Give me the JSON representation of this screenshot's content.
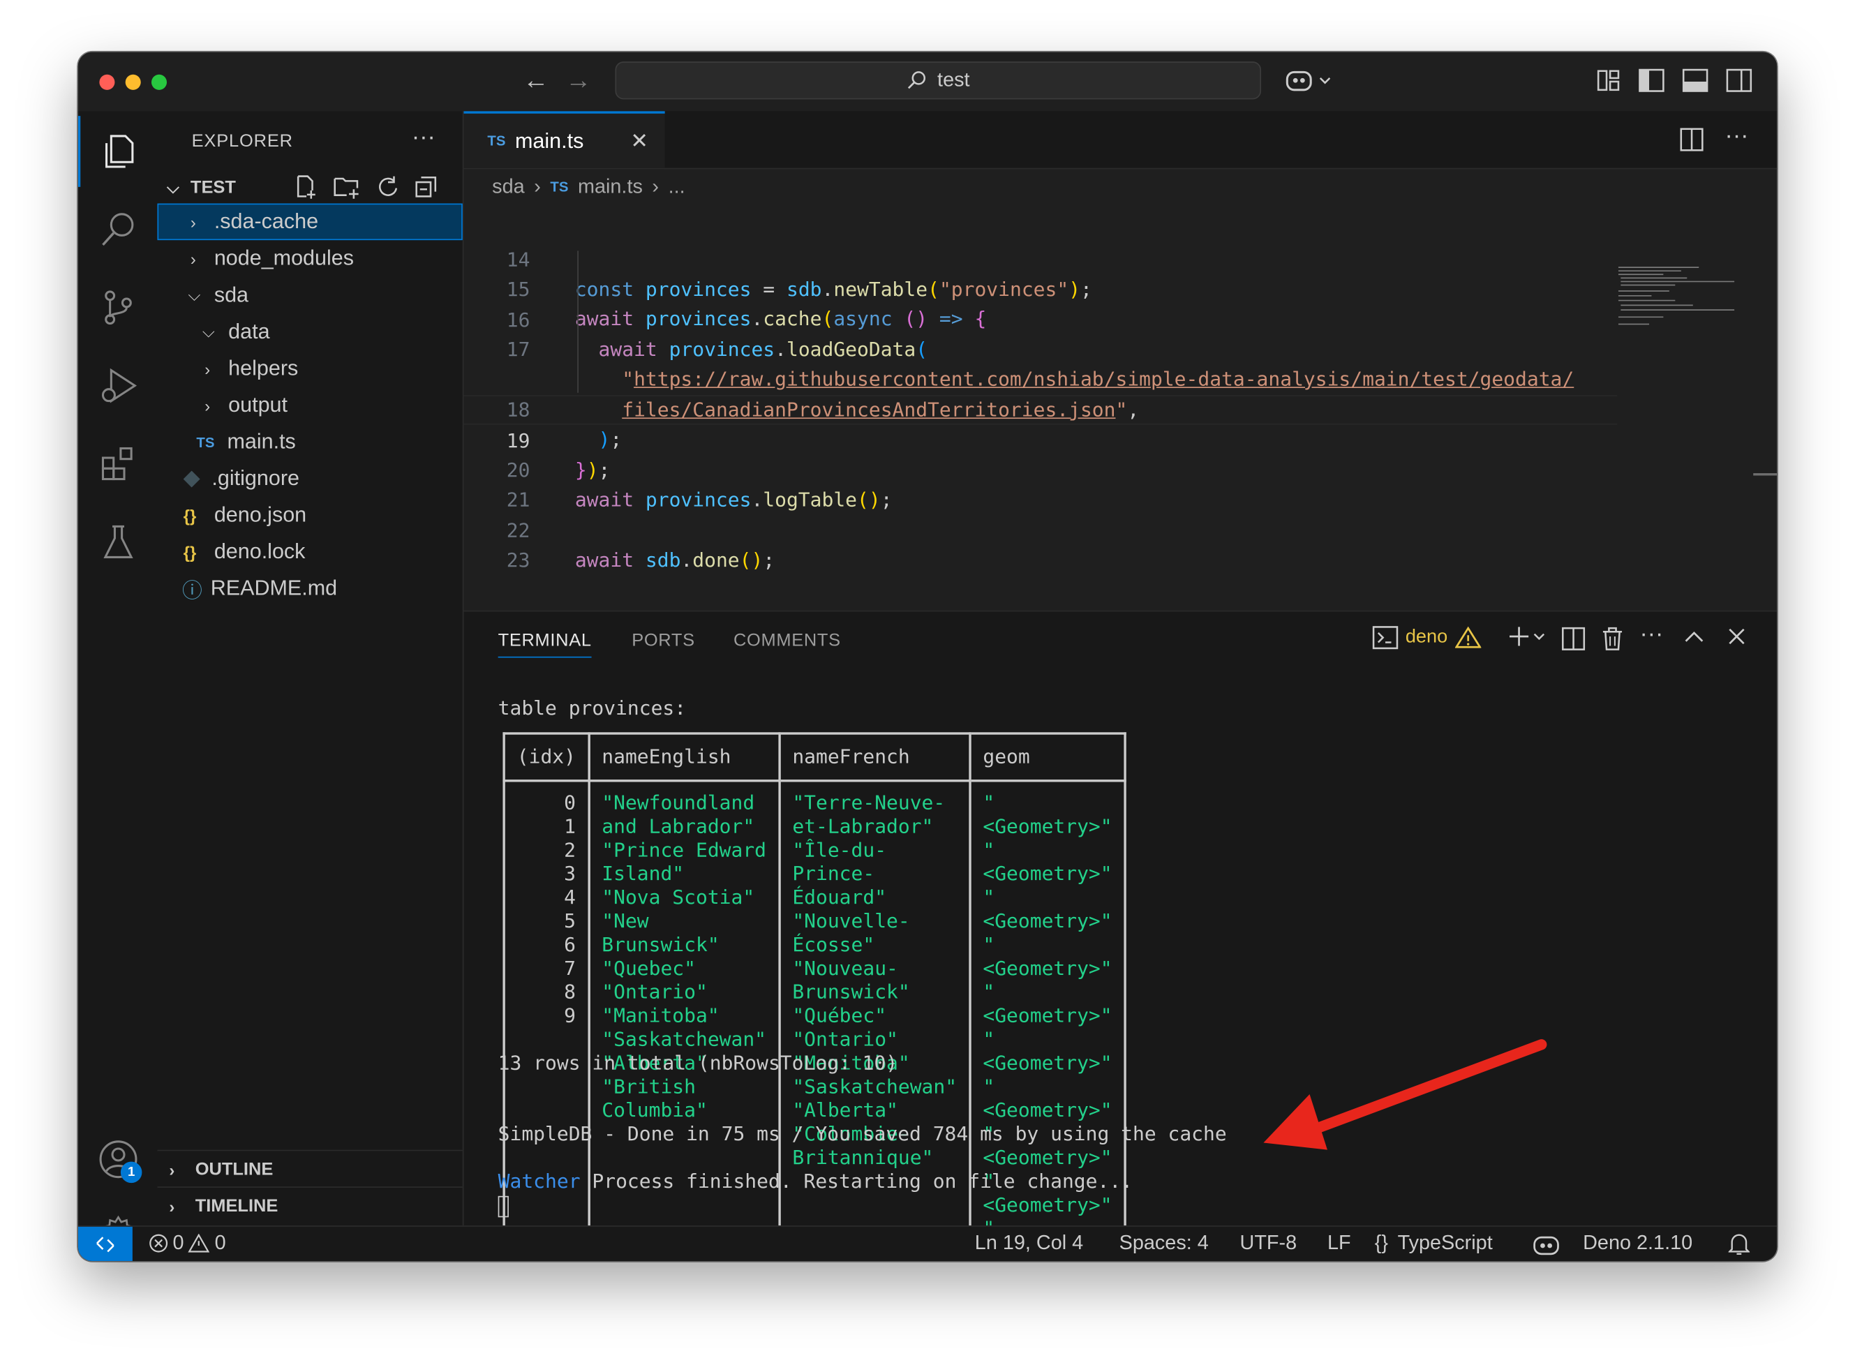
{
  "titlebar": {
    "search_text": "test",
    "back": "←",
    "forward": "→"
  },
  "sidebar": {
    "title": "EXPLORER",
    "more": "···",
    "folder": "TEST",
    "items": [
      {
        "label": ".sda-cache",
        "icon": "chevron-right-icon"
      },
      {
        "label": "node_modules",
        "icon": "chevron-right-icon"
      },
      {
        "label": "sda",
        "icon": "chevron-down-icon"
      },
      {
        "label": "data",
        "icon": "chevron-down-icon"
      },
      {
        "label": "helpers",
        "icon": "chevron-right-icon"
      },
      {
        "label": "output",
        "icon": "chevron-right-icon"
      },
      {
        "label": "main.ts",
        "icon": "typescript-icon",
        "icon_text": "TS"
      },
      {
        "label": ".gitignore",
        "icon": "git-icon"
      },
      {
        "label": "deno.json",
        "icon": "json-icon",
        "icon_text": "{}"
      },
      {
        "label": "deno.lock",
        "icon": "json-icon",
        "icon_text": "{}"
      },
      {
        "label": "README.md",
        "icon": "info-icon",
        "icon_text": "ⓘ"
      }
    ],
    "outline": "OUTLINE",
    "timeline": "TIMELINE"
  },
  "editor": {
    "tab_label": "main.ts",
    "tab_icon_text": "TS",
    "breadcrumb": [
      "sda",
      "main.ts",
      "..."
    ],
    "active_line": 19,
    "line_numbers": [
      "14",
      "15",
      "16",
      "17",
      "",
      "18",
      "19",
      "20",
      "21",
      "22",
      "23"
    ]
  },
  "panel": {
    "tabs": [
      "TERMINAL",
      "PORTS",
      "COMMENTS"
    ],
    "terminal_name": "deno",
    "table_title": "table provinces:",
    "columns": [
      "(idx)",
      "nameEnglish",
      "nameFrench",
      "geom"
    ],
    "rows": [
      {
        "idx": "0",
        "en": "\"Newfoundland and Labrador\"",
        "fr": "\"Terre-Neuve-et-Labrador\"",
        "geom": "\"<Geometry>\""
      },
      {
        "idx": "1",
        "en": "\"Prince Edward Island\"",
        "fr": "\"Île-du-Prince-Édouard\"",
        "geom": "\"<Geometry>\""
      },
      {
        "idx": "2",
        "en": "\"Nova Scotia\"",
        "fr": "\"Nouvelle-Écosse\"",
        "geom": "\"<Geometry>\""
      },
      {
        "idx": "3",
        "en": "\"New Brunswick\"",
        "fr": "\"Nouveau-Brunswick\"",
        "geom": "\"<Geometry>\""
      },
      {
        "idx": "4",
        "en": "\"Quebec\"",
        "fr": "\"Québec\"",
        "geom": "\"<Geometry>\""
      },
      {
        "idx": "5",
        "en": "\"Ontario\"",
        "fr": "\"Ontario\"",
        "geom": "\"<Geometry>\""
      },
      {
        "idx": "6",
        "en": "\"Manitoba\"",
        "fr": "\"Manitoba\"",
        "geom": "\"<Geometry>\""
      },
      {
        "idx": "7",
        "en": "\"Saskatchewan\"",
        "fr": "\"Saskatchewan\"",
        "geom": "\"<Geometry>\""
      },
      {
        "idx": "8",
        "en": "\"Alberta\"",
        "fr": "\"Alberta\"",
        "geom": "\"<Geometry>\""
      },
      {
        "idx": "9",
        "en": "\"British Columbia\"",
        "fr": "\"Colombie-Britannique\"",
        "geom": "\"<Geometry>\""
      }
    ],
    "rows_total": "13 rows in total (nbRowsToLog: 10)",
    "done_message": "SimpleDB - Done in 75 ms / You saved 784 ms by using the cache",
    "watcher_label": "Watcher",
    "watcher_message": " Process finished. Restarting on file change..."
  },
  "statusbar": {
    "errors": "0",
    "warnings": "0",
    "position": "Ln 19, Col 4",
    "spaces": "Spaces: 4",
    "encoding": "UTF-8",
    "eol": "LF",
    "language": "TypeScript",
    "language_icon_text": "{}",
    "deno_version": "Deno 2.1.10"
  },
  "account_badge": "1",
  "colors": {
    "accent": "#0078d4",
    "terminal_string": "#23d18b",
    "annotation_arrow": "#e8261c"
  }
}
